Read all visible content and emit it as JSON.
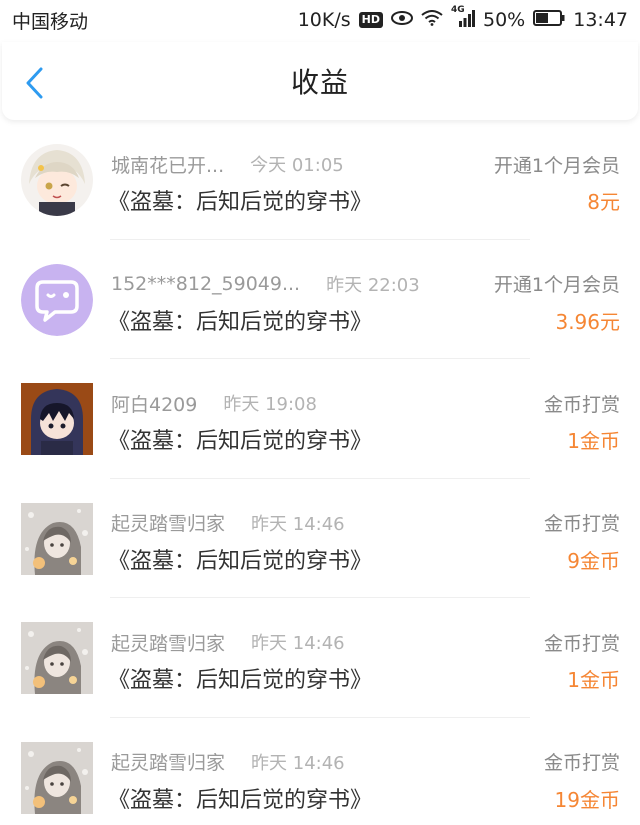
{
  "status_bar": {
    "carrier": "中国移动",
    "speed": "10K/s",
    "hd": "HD",
    "network": "4G",
    "battery": "50%",
    "time": "13:47"
  },
  "header": {
    "title": "收益"
  },
  "colors": {
    "accent_orange": "#f58634",
    "back_blue": "#2e9bf0"
  },
  "records": [
    {
      "username": "城南花已开...",
      "time": "今天 01:05",
      "type": "开通1个月会员",
      "book": "《盗墓：后知后觉的穿书》",
      "amount": "8元",
      "avatar": "anime-boy-avatar"
    },
    {
      "username": "152***812_59049...",
      "time": "昨天 22:03",
      "type": "开通1个月会员",
      "book": "《盗墓：后知后觉的穿书》",
      "amount": "3.96元",
      "avatar": "default-chat-avatar"
    },
    {
      "username": "阿白4209",
      "time": "昨天 19:08",
      "type": "金币打赏",
      "book": "《盗墓：后知后觉的穿书》",
      "amount": "1金币",
      "avatar": "hooded-chibi-avatar"
    },
    {
      "username": "起灵踏雪归家",
      "time": "昨天 14:46",
      "type": "金币打赏",
      "book": "《盗墓：后知后觉的穿书》",
      "amount": "9金币",
      "avatar": "anime-girl-avatar"
    },
    {
      "username": "起灵踏雪归家",
      "time": "昨天 14:46",
      "type": "金币打赏",
      "book": "《盗墓：后知后觉的穿书》",
      "amount": "1金币",
      "avatar": "anime-girl-avatar"
    },
    {
      "username": "起灵踏雪归家",
      "time": "昨天 14:46",
      "type": "金币打赏",
      "book": "《盗墓：后知后觉的穿书》",
      "amount": "19金币",
      "avatar": "anime-girl-avatar"
    }
  ]
}
